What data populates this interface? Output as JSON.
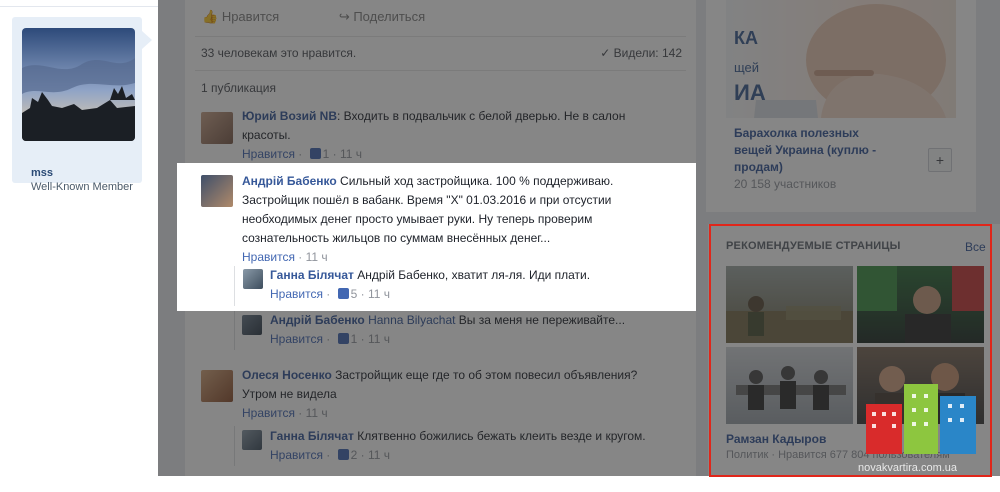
{
  "user": {
    "name": "mss",
    "title": "Well-Known Member"
  },
  "post": {
    "like_action": "Нравится",
    "share_action": "Поделиться",
    "likes_line": "33 человекам это нравится.",
    "views": "Видели: 142",
    "publications": "1 публикация"
  },
  "comments": [
    {
      "author": "Юрий Возий NB",
      "text1": ": Входить в подвальчик с белой дверью. Не в салон",
      "text2": "красоты.",
      "like": "Нравится",
      "likes": "1",
      "time": "11 ч"
    },
    {
      "author": "Андрій Бабенко",
      "text1": " Сильный ход застройщика. 100 % поддерживаю.",
      "text2": "Застройщик пошёл в вабанк. Время \"Х\" 01.03.2016 и при отсустии",
      "text3": "необходимых денег просто умывает руки. Ну теперь проверим",
      "text4": "сознательность жильцов по суммам внесённых денег...",
      "like": "Нравится",
      "time": "11 ч"
    },
    {
      "author": "Ганна Білячат",
      "text1": " Андрій Бабенко, хватит ля-ля. Иди плати.",
      "like": "Нравится",
      "likes": "5",
      "time": "11 ч"
    },
    {
      "author": "Андрій Бабенко",
      "mention": "Hanna Bilyachat",
      "text1": " Вы за меня не переживайте...",
      "like": "Нравится",
      "likes": "1",
      "time": "11 ч"
    },
    {
      "author": "Олеся Носенко",
      "text1": " Застройщик еще где то об этом повесил объявления?",
      "text2": "Утром не видела",
      "like": "Нравится",
      "time": "11 ч"
    },
    {
      "author": "Ганна Білячат",
      "text1": " Клятвенно божились бежать клеить везде и кругом.",
      "like": "Нравится",
      "likes": "2",
      "time": "11 ч"
    }
  ],
  "group": {
    "banner_lines": [
      "КА",
      "щей",
      "ИА"
    ],
    "name_lines": [
      "Барахолка полезных",
      "вещей Украина (куплю -",
      "продам)"
    ],
    "members": "20 158 участников",
    "plus": "+"
  },
  "recommended": {
    "title": "РЕКОМЕНДУЕМЫЕ СТРАНИЦЫ",
    "all": "Все",
    "name": "Рамзан Кадыров",
    "meta": "Политик · Нравится 677 804 пользователям"
  },
  "watermark": "novakvartira.com.ua"
}
